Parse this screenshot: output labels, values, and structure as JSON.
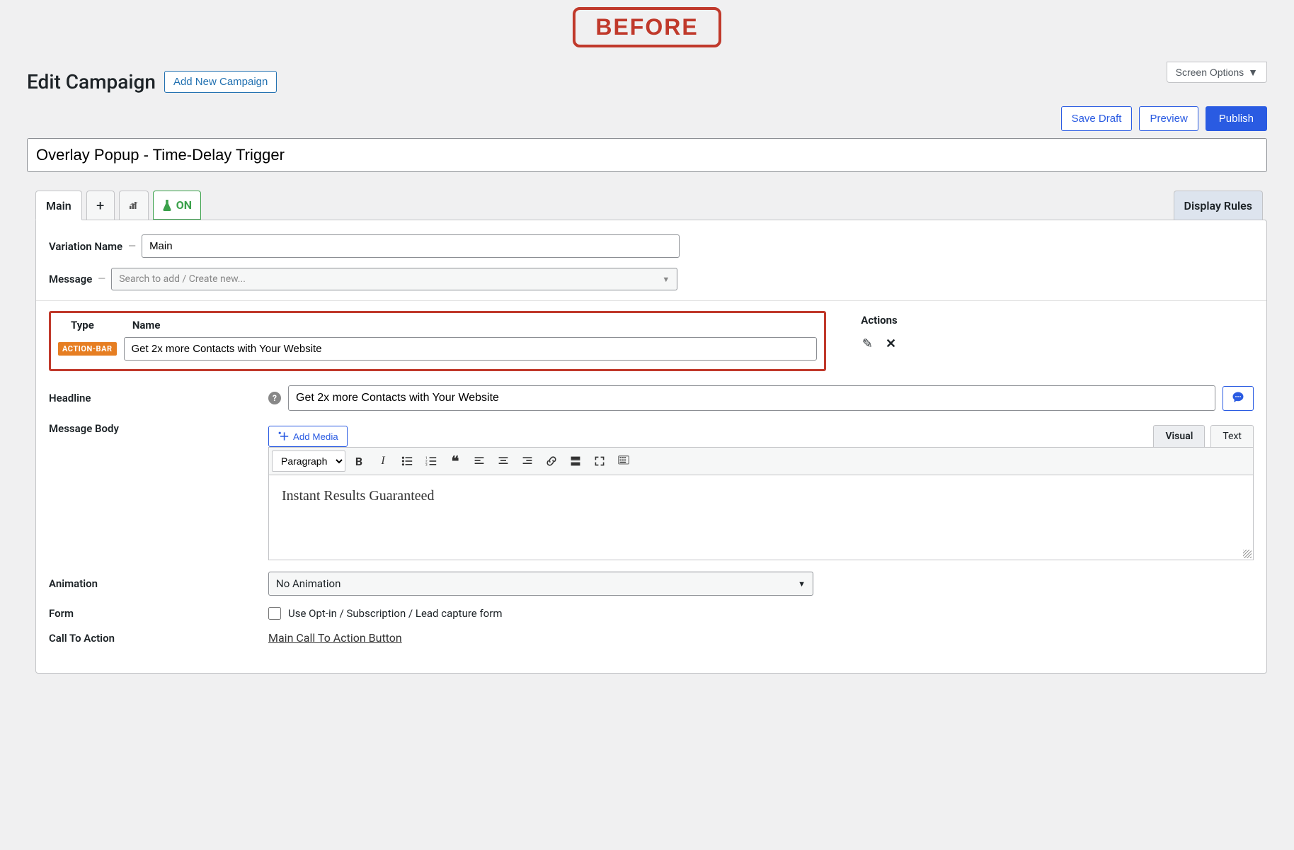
{
  "stamp_label": "BEFORE",
  "header": {
    "screen_options": "Screen Options",
    "page_title": "Edit Campaign",
    "add_new": "Add New Campaign",
    "save_draft": "Save Draft",
    "preview": "Preview",
    "publish": "Publish"
  },
  "campaign_title": "Overlay Popup - Time-Delay Trigger",
  "tabs": {
    "main": "Main",
    "ab_toggle": "ON",
    "display_rules": "Display Rules"
  },
  "variation": {
    "name_label": "Variation Name",
    "name_value": "Main",
    "message_label": "Message",
    "message_placeholder": "Search to add / Create new..."
  },
  "message_row": {
    "type_heading": "Type",
    "name_heading": "Name",
    "badge": "ACTION-BAR",
    "name_value": "Get 2x more Contacts with Your Website",
    "actions_heading": "Actions"
  },
  "fields": {
    "headline_label": "Headline",
    "headline_value": "Get 2x more Contacts with Your Website",
    "message_body_label": "Message Body",
    "add_media": "Add Media",
    "visual_tab": "Visual",
    "text_tab": "Text",
    "paragraph_option": "Paragraph",
    "body_content": "Instant Results Guaranteed",
    "animation_label": "Animation",
    "animation_value": "No Animation",
    "form_label": "Form",
    "form_checkbox_label": "Use Opt-in / Subscription / Lead capture form",
    "cta_label": "Call To Action",
    "cta_link": "Main Call To Action Button"
  }
}
